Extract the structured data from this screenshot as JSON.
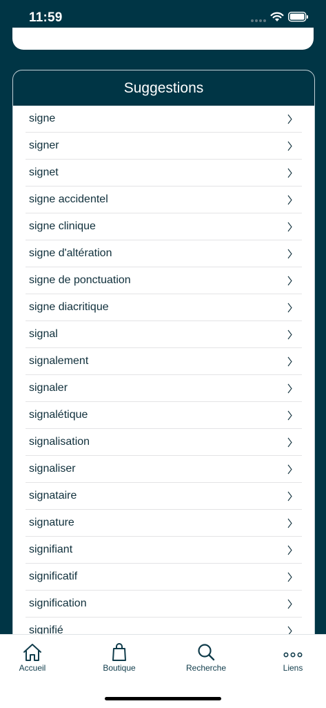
{
  "status_bar": {
    "time": "11:59"
  },
  "suggestions": {
    "title": "Suggestions",
    "items": [
      "signe",
      "signer",
      "signet",
      "signe accidentel",
      "signe clinique",
      "signe d'altération",
      "signe de ponctuation",
      "signe diacritique",
      "signal",
      "signalement",
      "signaler",
      "signalétique",
      "signalisation",
      "signaliser",
      "signataire",
      "signature",
      "signifiant",
      "significatif",
      "signification",
      "signifié"
    ]
  },
  "tab_bar": {
    "items": [
      {
        "label": "Accueil",
        "icon": "home-icon"
      },
      {
        "label": "Boutique",
        "icon": "shopping-bag-icon"
      },
      {
        "label": "Recherche",
        "icon": "search-icon"
      },
      {
        "label": "Liens",
        "icon": "more-dots-icon"
      }
    ]
  },
  "colors": {
    "background": "#003545",
    "text": "#0f2f3b",
    "tab_text": "#0f3b4a"
  }
}
